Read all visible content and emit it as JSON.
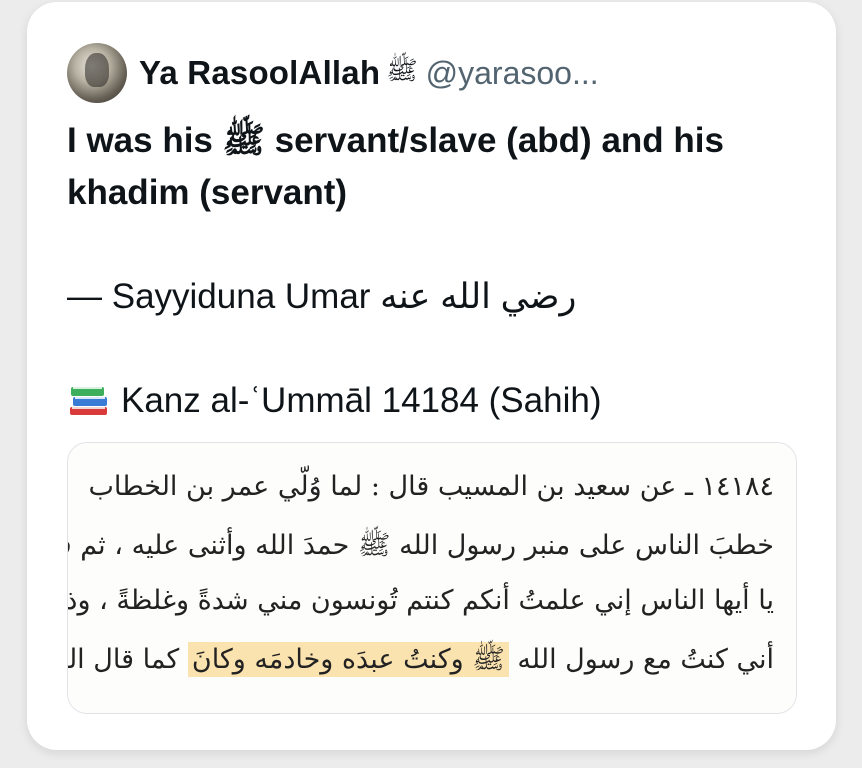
{
  "post": {
    "author": {
      "display_name": "Ya RasoolAllah",
      "salawat_glyph": "ﷺ",
      "handle": "@yarasoo..."
    },
    "text": {
      "line1_bold": "I was his ﷺ servant/slave (abd) and his khadim (servant)",
      "attribution": "— Sayyiduna Umar رضي الله عنه",
      "source_icon": "books-icon",
      "source": "Kanz al-ʿUmmāl 14184 (Sahih)"
    },
    "image": {
      "lines": [
        "١٤١٨٤ ـ عن سعيد بن المسيب قال : لما وُلّي عمر بن الخطاب",
        "خطبَ الناس على منبر رسول الله ﷺ حمدَ الله وأثنى عليه ، ثم قال :",
        "يا أيها الناس إني علمتُ أنكم كنتم تُونسون مني شدةً وغلظةً ، وذلك"
      ],
      "last_line_before": "أني كنتُ مع رسول الله",
      "last_line_highlight": "ﷺ وكنتُ عبدَه وخادمَه وكانَ",
      "last_line_after": "كما قال الله"
    }
  }
}
